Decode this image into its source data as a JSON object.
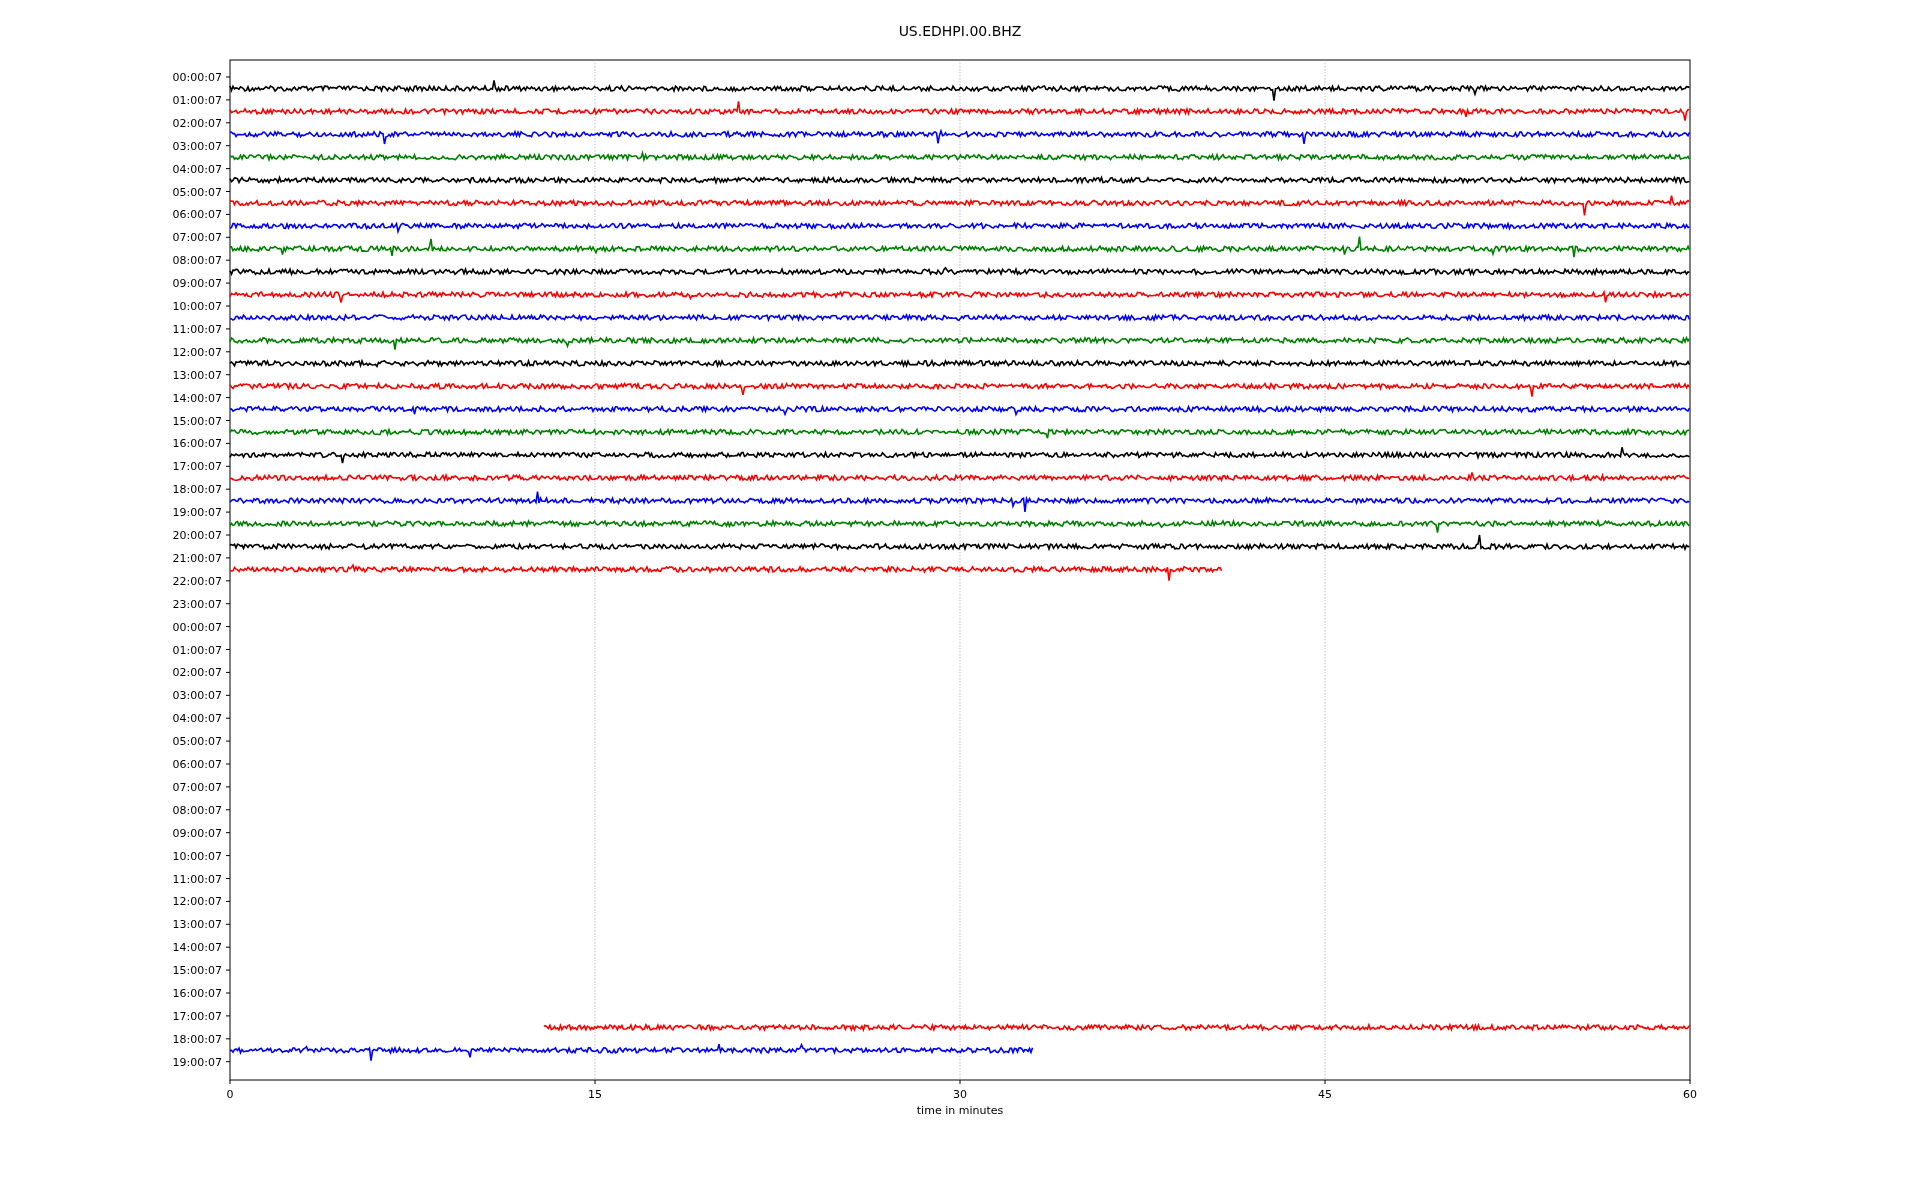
{
  "title": "US.EDHPI.00.BHZ",
  "x_axis": {
    "label": "time in minutes",
    "ticks": [
      "0",
      "15",
      "30",
      "45",
      "60"
    ]
  },
  "rows": [
    {
      "label": "00:00:07",
      "trace": {
        "kind": "full",
        "color": "#000000"
      }
    },
    {
      "label": "01:00:07",
      "trace": {
        "kind": "full",
        "color": "#ff0000"
      }
    },
    {
      "label": "02:00:07",
      "trace": {
        "kind": "full",
        "color": "#0000ff"
      }
    },
    {
      "label": "03:00:07",
      "trace": {
        "kind": "full",
        "color": "#008000"
      }
    },
    {
      "label": "04:00:07",
      "trace": {
        "kind": "full",
        "color": "#000000"
      }
    },
    {
      "label": "05:00:07",
      "trace": {
        "kind": "full",
        "color": "#ff0000"
      }
    },
    {
      "label": "06:00:07",
      "trace": {
        "kind": "full",
        "color": "#0000ff"
      }
    },
    {
      "label": "07:00:07",
      "trace": {
        "kind": "full",
        "color": "#008000"
      }
    },
    {
      "label": "08:00:07",
      "trace": {
        "kind": "full",
        "color": "#000000"
      }
    },
    {
      "label": "09:00:07",
      "trace": {
        "kind": "full",
        "color": "#ff0000"
      }
    },
    {
      "label": "10:00:07",
      "trace": {
        "kind": "full",
        "color": "#0000ff"
      }
    },
    {
      "label": "11:00:07",
      "trace": {
        "kind": "full",
        "color": "#008000"
      }
    },
    {
      "label": "12:00:07",
      "trace": {
        "kind": "full",
        "color": "#000000"
      }
    },
    {
      "label": "13:00:07",
      "trace": {
        "kind": "full",
        "color": "#ff0000"
      }
    },
    {
      "label": "14:00:07",
      "trace": {
        "kind": "full",
        "color": "#0000ff"
      }
    },
    {
      "label": "15:00:07",
      "trace": {
        "kind": "full",
        "color": "#008000"
      }
    },
    {
      "label": "16:00:07",
      "trace": {
        "kind": "full",
        "color": "#000000"
      }
    },
    {
      "label": "17:00:07",
      "trace": {
        "kind": "full",
        "color": "#ff0000"
      }
    },
    {
      "label": "18:00:07",
      "trace": {
        "kind": "full",
        "color": "#0000ff"
      }
    },
    {
      "label": "19:00:07",
      "trace": {
        "kind": "full",
        "color": "#008000"
      }
    },
    {
      "label": "20:00:07",
      "trace": {
        "kind": "full",
        "color": "#000000"
      }
    },
    {
      "label": "21:00:07",
      "trace": {
        "kind": "head",
        "color": "#ff0000",
        "level": 0.68
      }
    },
    {
      "label": "22:00:07",
      "trace": {
        "kind": "none"
      }
    },
    {
      "label": "23:00:07",
      "trace": {
        "kind": "none"
      }
    },
    {
      "label": "00:00:07",
      "trace": {
        "kind": "none"
      }
    },
    {
      "label": "01:00:07",
      "trace": {
        "kind": "none"
      }
    },
    {
      "label": "02:00:07",
      "trace": {
        "kind": "none"
      }
    },
    {
      "label": "03:00:07",
      "trace": {
        "kind": "none"
      }
    },
    {
      "label": "04:00:07",
      "trace": {
        "kind": "none"
      }
    },
    {
      "label": "05:00:07",
      "trace": {
        "kind": "none"
      }
    },
    {
      "label": "06:00:07",
      "trace": {
        "kind": "none"
      }
    },
    {
      "label": "07:00:07",
      "trace": {
        "kind": "none"
      }
    },
    {
      "label": "08:00:07",
      "trace": {
        "kind": "none"
      }
    },
    {
      "label": "09:00:07",
      "trace": {
        "kind": "none"
      }
    },
    {
      "label": "10:00:07",
      "trace": {
        "kind": "none"
      }
    },
    {
      "label": "11:00:07",
      "trace": {
        "kind": "none"
      }
    },
    {
      "label": "12:00:07",
      "trace": {
        "kind": "none"
      }
    },
    {
      "label": "13:00:07",
      "trace": {
        "kind": "none"
      }
    },
    {
      "label": "14:00:07",
      "trace": {
        "kind": "none"
      }
    },
    {
      "label": "15:00:07",
      "trace": {
        "kind": "none"
      }
    },
    {
      "label": "16:00:07",
      "trace": {
        "kind": "none"
      }
    },
    {
      "label": "17:00:07",
      "trace": {
        "kind": "tail",
        "color": "#ff0000",
        "level": 0.785
      }
    },
    {
      "label": "18:00:07",
      "trace": {
        "kind": "head",
        "color": "#0000ff",
        "level": 0.55
      }
    },
    {
      "label": "19:00:07",
      "trace": {
        "kind": "none"
      }
    }
  ]
}
